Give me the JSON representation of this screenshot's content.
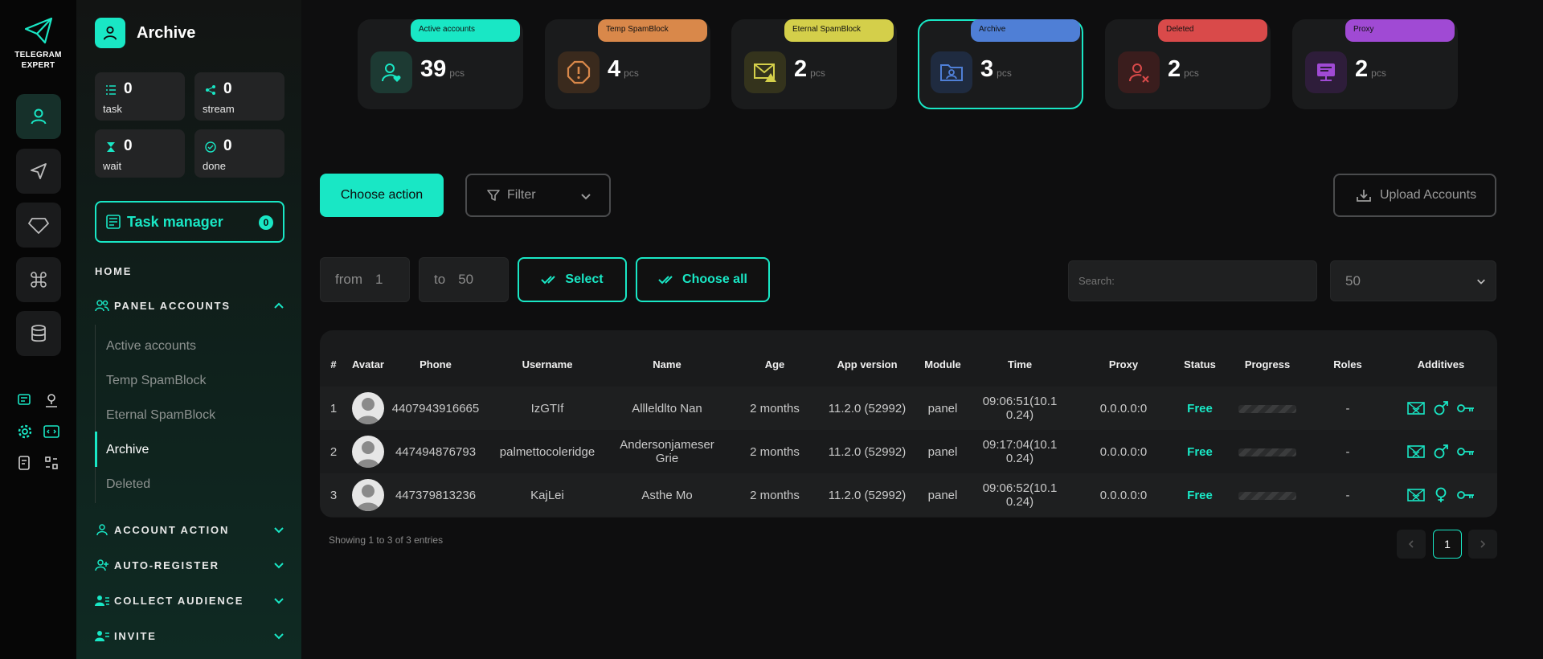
{
  "brand": {
    "name_line1": "TELEGRAM",
    "name_line2": "EXPERT"
  },
  "sidebar": {
    "title": "Archive",
    "stats": [
      {
        "value": "0",
        "label": "task"
      },
      {
        "value": "0",
        "label": "stream"
      },
      {
        "value": "0",
        "label": "wait"
      },
      {
        "value": "0",
        "label": "done"
      }
    ],
    "task_manager": {
      "label": "Task manager",
      "count": "0"
    },
    "home": "HOME",
    "sections": {
      "panel_accounts": "PANEL ACCOUNTS",
      "account_action": "ACCOUNT ACTION",
      "auto_register": "AUTO-REGISTER",
      "collect_audience": "COLLECT AUDIENCE",
      "invite": "INVITE"
    },
    "subitems": [
      "Active accounts",
      "Temp SpamBlock",
      "Eternal SpamBlock",
      "Archive",
      "Deleted"
    ]
  },
  "tabs": [
    {
      "label": "Active accounts",
      "count": "39",
      "unit": "pcs",
      "color": "#19e7c5"
    },
    {
      "label": "Temp SpamBlock",
      "count": "4",
      "unit": "pcs",
      "color": "#d9884a"
    },
    {
      "label": "Eternal SpamBlock",
      "count": "2",
      "unit": "pcs",
      "color": "#d4cf4a"
    },
    {
      "label": "Archive",
      "count": "3",
      "unit": "pcs",
      "color": "#4f7fd6"
    },
    {
      "label": "Deleted",
      "count": "2",
      "unit": "pcs",
      "color": "#d94a4a"
    },
    {
      "label": "Proxy",
      "count": "2",
      "unit": "pcs",
      "color": "#a04ad4"
    }
  ],
  "toolbar": {
    "choose_action": "Choose action",
    "filter": "Filter",
    "upload": "Upload Accounts",
    "from_label": "from",
    "from_value": "1",
    "to_label": "to",
    "to_value": "50",
    "select": "Select",
    "choose_all": "Choose all",
    "search_placeholder": "Search:",
    "page_size": "50"
  },
  "table": {
    "headers": [
      "#",
      "Avatar",
      "Phone",
      "Username",
      "Name",
      "Age",
      "App version",
      "Module",
      "Time",
      "Proxy",
      "Status",
      "Progress",
      "Roles",
      "Additives"
    ],
    "rows": [
      {
        "num": "1",
        "phone": "4407943916665",
        "username": "IzGTIf",
        "name": "Allleldlto Nan",
        "age": "2 months",
        "app": "11.2.0 (52992)",
        "module": "panel",
        "time": "09:06:51(10.10.24)",
        "proxy": "0.0.0.0:0",
        "status": "Free",
        "roles": "-",
        "gender": "male"
      },
      {
        "num": "2",
        "phone": "447494876793",
        "username": "palmettocoleridge",
        "name": "Andersonjameser Grie",
        "age": "2 months",
        "app": "11.2.0 (52992)",
        "module": "panel",
        "time": "09:17:04(10.10.24)",
        "proxy": "0.0.0.0:0",
        "status": "Free",
        "roles": "-",
        "gender": "male"
      },
      {
        "num": "3",
        "phone": "447379813236",
        "username": "KajLei",
        "name": "Asthe Mo",
        "age": "2 months",
        "app": "11.2.0 (52992)",
        "module": "panel",
        "time": "09:06:52(10.10.24)",
        "proxy": "0.0.0.0:0",
        "status": "Free",
        "roles": "-",
        "gender": "female"
      }
    ]
  },
  "footer": {
    "info": "Showing 1 to 3 of 3 entries",
    "page": "1"
  },
  "colors": {
    "accent": "#19e7c5"
  }
}
